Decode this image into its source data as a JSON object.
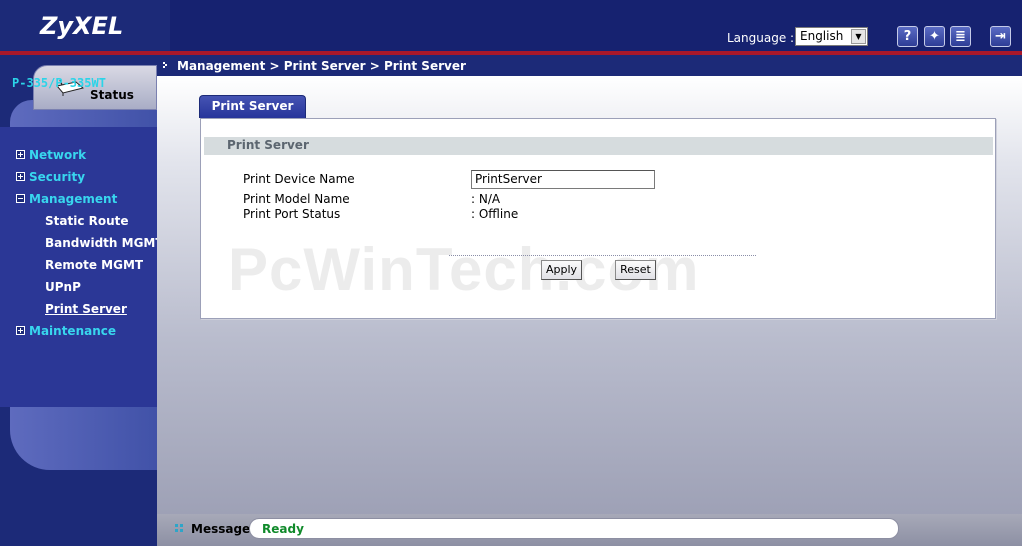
{
  "brand": {
    "logo": "ZyXEL"
  },
  "header": {
    "language_label": "Language :",
    "language_value": "English",
    "icons": [
      "help-icon",
      "wizard-icon",
      "document-icon",
      "logout-icon"
    ]
  },
  "sidebar": {
    "status_tab": "Status",
    "model": "P-335/P-335WT",
    "items": [
      {
        "label": "Network",
        "expanded": false
      },
      {
        "label": "Security",
        "expanded": false
      },
      {
        "label": "Management",
        "expanded": true
      },
      {
        "label": "Maintenance",
        "expanded": false
      }
    ],
    "management_sub": [
      "Static Route",
      "Bandwidth MGMT",
      "Remote MGMT",
      "UPnP",
      "Print Server"
    ],
    "active_sub": "Print Server"
  },
  "breadcrumb": "Management > Print Server > Print Server",
  "page": {
    "tab": "Print Server",
    "section_title": "Print Server",
    "fields": [
      {
        "label": "Print Device Name",
        "value": "PrintServer"
      },
      {
        "label": "Print Model Name",
        "value": ": N/A"
      },
      {
        "label": "Print Port Status",
        "value": ": Offline"
      }
    ],
    "apply_label": "Apply",
    "reset_label": "Reset"
  },
  "watermark": "PcWinTech.com",
  "message": {
    "label": "Message",
    "text": "Ready"
  },
  "colors": {
    "navy": "#1c2a78",
    "accent_red": "#a8182b",
    "nav_cyan": "#38d6ee",
    "ready_green": "#108a2a"
  }
}
